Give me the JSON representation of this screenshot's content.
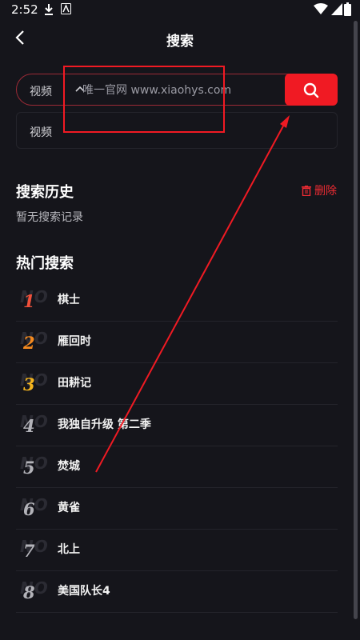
{
  "status_bar": {
    "time": "2:52"
  },
  "header": {
    "title": "搜索"
  },
  "search": {
    "scope": "视频",
    "placeholder": "唯一官网 www.xiaohys.com",
    "dropdown_option": "视频"
  },
  "history": {
    "title": "搜索历史",
    "delete_label": "删除",
    "empty_text": "暂无搜索记录"
  },
  "hot": {
    "title": "热门搜索",
    "watermark": "NO",
    "items": [
      {
        "rank": "1",
        "label": "棋士",
        "color": "#f0503a"
      },
      {
        "rank": "2",
        "label": "雁回时",
        "color": "#f58a1f"
      },
      {
        "rank": "3",
        "label": "田耕记",
        "color": "#f5b51e"
      },
      {
        "rank": "4",
        "label": "我独自升级 第二季",
        "color": "#b3b3b9"
      },
      {
        "rank": "5",
        "label": "焚城",
        "color": "#b3b3b9"
      },
      {
        "rank": "6",
        "label": "黄雀",
        "color": "#b3b3b9"
      },
      {
        "rank": "7",
        "label": "北上",
        "color": "#b3b3b9"
      },
      {
        "rank": "8",
        "label": "美国队长4",
        "color": "#b3b3b9"
      }
    ]
  },
  "colors": {
    "accent": "#f01a23",
    "background": "#15151b"
  }
}
